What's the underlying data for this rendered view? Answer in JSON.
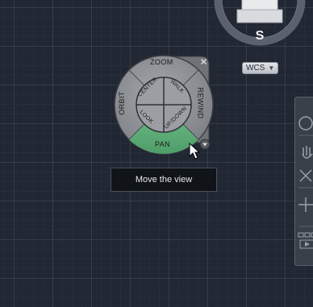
{
  "viewcube": {
    "compass_label": "S",
    "coordinate_menu": {
      "selected": "WCS"
    }
  },
  "steering_wheel": {
    "outer": {
      "top_label": "ZOOM",
      "left_label": "ORBIT",
      "right_label": "REWIND",
      "bottom_label": "PAN"
    },
    "inner": {
      "top_left_label": "CENTER",
      "top_right_label": "WALK",
      "bottom_left_label": "LOOK",
      "bottom_right_label": "UP/DOWN"
    },
    "highlighted": "PAN",
    "highlight_color": "#5fb27a",
    "wheel_color": "#8c8f93"
  },
  "tooltip": {
    "text": "Move the view"
  },
  "icons": {
    "close": "close-icon",
    "menu": "wheel-menu-icon",
    "cursor": "mouse-pointer-icon",
    "nav_bar": [
      "steering-wheel-icon",
      "pan-icon",
      "zoom-extents-icon",
      "orbit-icon",
      "showmotion-icon"
    ]
  }
}
